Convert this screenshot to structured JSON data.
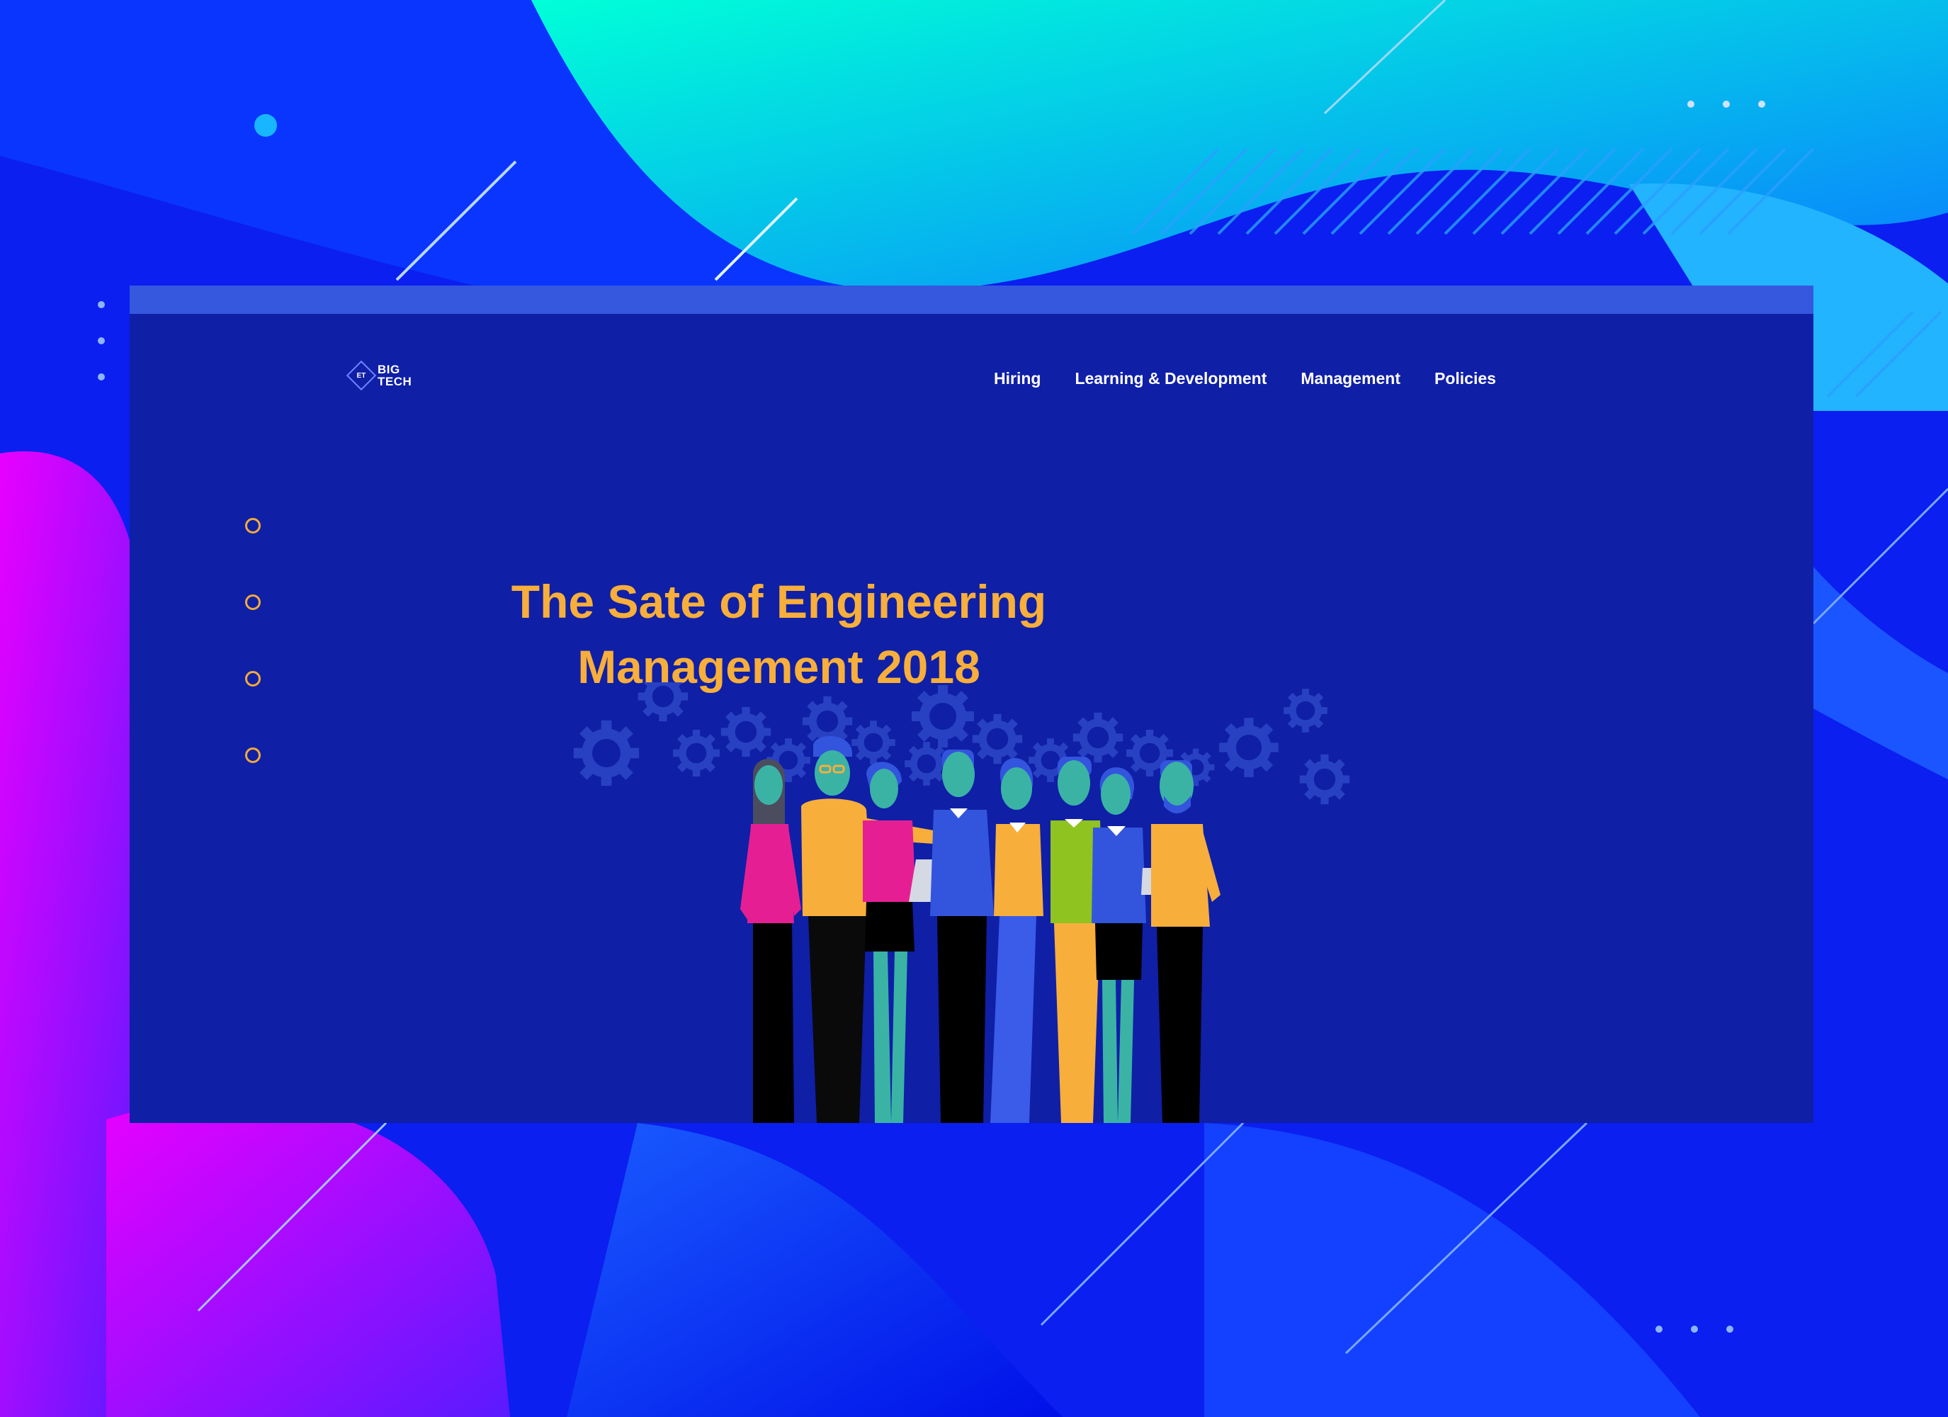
{
  "brand": {
    "logo_mark": "ET",
    "logo_line1": "BIG",
    "logo_line2": "TECH"
  },
  "nav": {
    "items": [
      {
        "label": "Hiring"
      },
      {
        "label": "Learning & Development"
      },
      {
        "label": "Management"
      },
      {
        "label": "Policies"
      }
    ]
  },
  "hero": {
    "title_line1": "The Sate of Engineering",
    "title_line2": "Management 2018"
  },
  "side_dots": {
    "count": 4
  },
  "colors": {
    "page_bg": "#0f1fa6",
    "browser_bar": "#3558de",
    "accent_yellow": "#f7ae3b",
    "nav_text": "#ffffff",
    "outer_bg_blue": "#0a1ff0",
    "outer_cyan": "#00f0e0",
    "outer_magenta": "#d400ff"
  }
}
